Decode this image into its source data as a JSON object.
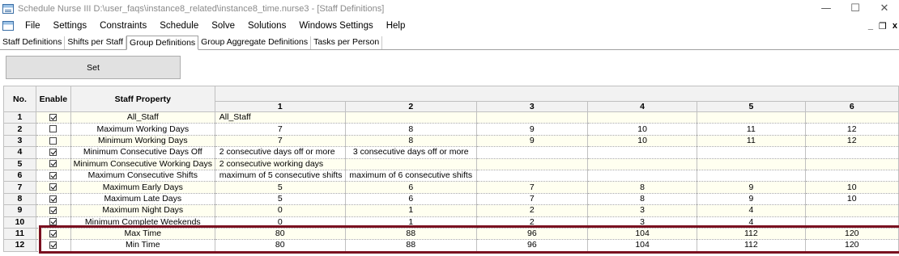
{
  "window": {
    "title": "Schedule Nurse III  D:\\user_faqs\\instance8_related\\instance8_time.nurse3 - [Staff Definitions]",
    "controls": [
      "—",
      "☐",
      "✕"
    ],
    "mdi_controls": [
      "_",
      "❐",
      "x"
    ]
  },
  "menu": [
    "File",
    "Settings",
    "Constraints",
    "Schedule",
    "Solve",
    "Solutions",
    "Windows Settings",
    "Help"
  ],
  "tabs": [
    {
      "label": "Staff Definitions",
      "active": false
    },
    {
      "label": "Shifts per Staff",
      "active": false
    },
    {
      "label": "Group Definitions",
      "active": true
    },
    {
      "label": "Group Aggregate Definitions",
      "active": false
    },
    {
      "label": "Tasks per Person",
      "active": false
    }
  ],
  "set_button": "Set",
  "grid": {
    "headers": {
      "no": "No.",
      "enable": "Enable",
      "property": "Staff Property"
    },
    "columns": [
      "1",
      "2",
      "3",
      "4",
      "5",
      "6"
    ],
    "rows": [
      {
        "no": "1",
        "enabled": true,
        "property": "All_Staff",
        "values": [
          "All_Staff",
          "",
          "",
          "",
          "",
          ""
        ]
      },
      {
        "no": "2",
        "enabled": false,
        "property": "Maximum Working Days",
        "values": [
          "7",
          "8",
          "9",
          "10",
          "11",
          "12"
        ]
      },
      {
        "no": "3",
        "enabled": false,
        "property": "Minimum Working Days",
        "values": [
          "7",
          "8",
          "9",
          "10",
          "11",
          "12"
        ]
      },
      {
        "no": "4",
        "enabled": true,
        "property": "Minimum Consecutive Days Off",
        "values": [
          "2 consecutive days off or more",
          "3 consecutive days off or more",
          "",
          "",
          "",
          ""
        ]
      },
      {
        "no": "5",
        "enabled": true,
        "property": "Minimum Consecutive Working Days",
        "values": [
          "2 consecutive working days",
          "",
          "",
          "",
          "",
          ""
        ]
      },
      {
        "no": "6",
        "enabled": true,
        "property": "Maximum Consecutive Shifts",
        "values": [
          "maximum of 5 consecutive shifts",
          "maximum of 6 consecutive shifts",
          "",
          "",
          "",
          ""
        ]
      },
      {
        "no": "7",
        "enabled": true,
        "property": "Maximum Early Days",
        "values": [
          "5",
          "6",
          "7",
          "8",
          "9",
          "10"
        ]
      },
      {
        "no": "8",
        "enabled": true,
        "property": "Maximum Late Days",
        "values": [
          "5",
          "6",
          "7",
          "8",
          "9",
          "10"
        ]
      },
      {
        "no": "9",
        "enabled": true,
        "property": "Maximum Night Days",
        "values": [
          "0",
          "1",
          "2",
          "3",
          "4",
          ""
        ]
      },
      {
        "no": "10",
        "enabled": true,
        "property": "Minimum Complete Weekends",
        "values": [
          "0",
          "1",
          "2",
          "3",
          "4",
          ""
        ]
      },
      {
        "no": "11",
        "enabled": true,
        "property": "Max Time",
        "values": [
          "80",
          "88",
          "96",
          "104",
          "112",
          "120"
        ]
      },
      {
        "no": "12",
        "enabled": true,
        "property": "Min Time",
        "values": [
          "80",
          "88",
          "96",
          "104",
          "112",
          "120"
        ]
      }
    ]
  },
  "colors": {
    "highlight_border": "#7a1020",
    "odd_row": "#fffff0",
    "header_bg": "#f2f2f2"
  }
}
